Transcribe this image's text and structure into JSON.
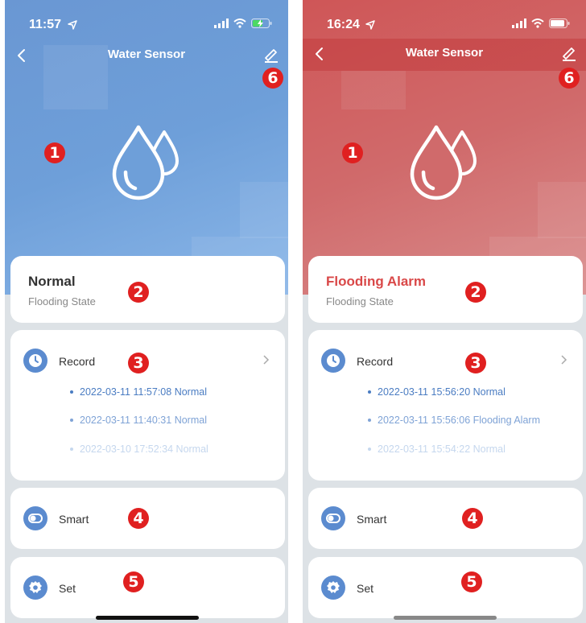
{
  "screens": [
    {
      "status_time": "11:57",
      "title": "Water Sensor",
      "state_value": "Normal",
      "state_label": "Flooding State",
      "record_label": "Record",
      "records": [
        "2022-03-11 11:57:08 Normal",
        "2022-03-11 11:40:31 Normal",
        "2022-03-10 17:52:34 Normal"
      ],
      "smart_label": "Smart",
      "set_label": "Set",
      "theme_color": "#6e9fd9"
    },
    {
      "status_time": "16:24",
      "title": "Water Sensor",
      "state_value": "Flooding Alarm",
      "state_label": "Flooding State",
      "record_label": "Record",
      "records": [
        "2022-03-11 15:56:20 Normal",
        "2022-03-11 15:56:06 Flooding Alarm",
        "2022-03-11 15:54:22 Normal"
      ],
      "smart_label": "Smart",
      "set_label": "Set",
      "theme_color": "#d06a6b"
    }
  ],
  "markers": [
    "1",
    "2",
    "3",
    "4",
    "5",
    "6"
  ],
  "colors": {
    "accent_blue": "#5b8bcf",
    "marker_red": "#e02020",
    "alarm_red": "#d94848"
  }
}
